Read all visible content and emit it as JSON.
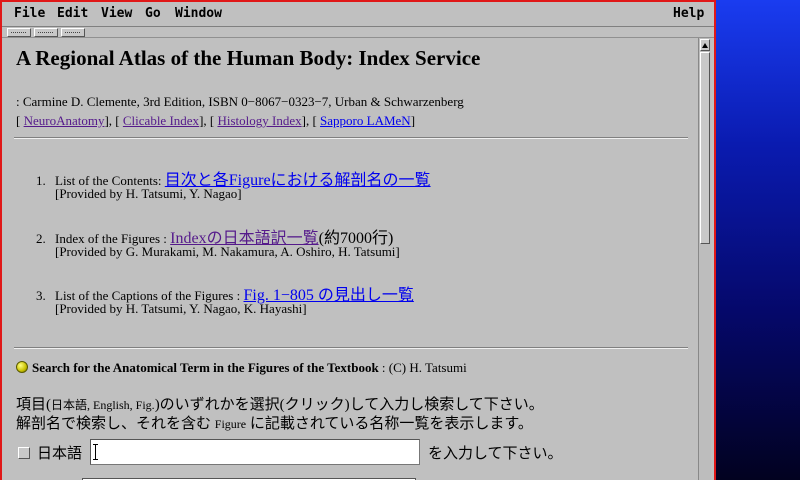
{
  "menu": {
    "file": "File",
    "edit": "Edit",
    "view": "View",
    "go": "Go",
    "window": "Window",
    "help": "Help"
  },
  "page": {
    "title": "A Regional Atlas of the Human Body: Index Service",
    "byline": ": Carmine D. Clemente, 3rd Edition, ISBN 0−8067−0323−7, Urban & Schwarzenberg",
    "links": [
      "NeuroAnatomy",
      "Clicable Index",
      "Histology Index",
      "Sapporo LAMeN"
    ],
    "link_separators": [
      "[ ",
      "], [ ",
      "], [ ",
      "], [ ",
      "]"
    ]
  },
  "list": [
    {
      "number": "1.",
      "label": "List of the Contents:",
      "link": "目次と各Figureにおける解剖名の一覧",
      "suffix": "",
      "provided": "[Provided by H. Tatsumi, Y. Nagao]"
    },
    {
      "number": "2.",
      "label": "Index of the Figures :",
      "link": "Indexの日本語訳一覧",
      "suffix": "(約7000行)",
      "provided": "[Provided by G. Murakami, M. Nakamura, A. Oshiro, H. Tatsumi]"
    },
    {
      "number": "3.",
      "label": "List of the Captions of the Figures :",
      "link": "Fig. 1−805 の見出し一覧",
      "suffix": "",
      "provided": "[Provided by H. Tatsumi, Y. Nagao, K. Hayashi]"
    }
  ],
  "search": {
    "heading": "Search for the Anatomical Term in the Figures of the Textbook",
    "credit": " : (C) H. Tatsumi",
    "instr1_a": "項目(",
    "instr1_b": "日本語, English, Fig.",
    "instr1_c": ")のいずれかを選択(クリック)して入力し検索して下さい。",
    "instr2_a": "解剖名で検索し、それを含む ",
    "instr2_b": "Figure",
    "instr2_c": " に記載されている名称一覧を表示します。",
    "jp_label": "日本語",
    "jp_value": "",
    "jp_suffix": "を入力して下さい。"
  },
  "colors": {
    "link": "#0000ee",
    "visited": "#551a8b",
    "window_border": "#e01818",
    "chrome": "#c0c0c0"
  }
}
